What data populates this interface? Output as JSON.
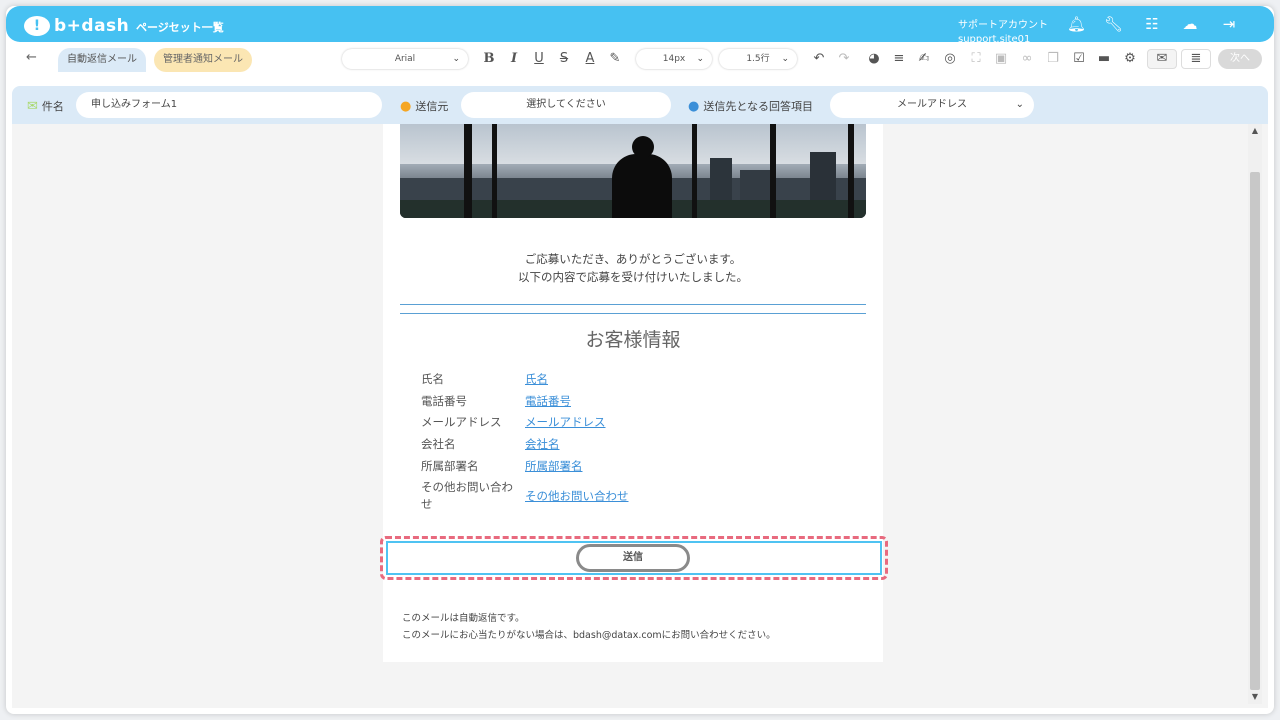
{
  "header": {
    "logo_text": "b+dash",
    "title": "ページセット一覧",
    "account_line1": "サポートアカウント",
    "account_line2": "support.site01"
  },
  "toolbar": {
    "back_glyph": "←",
    "tabs": [
      {
        "label": "自動返信メール",
        "active": true
      },
      {
        "label": "管理者通知メール",
        "active": false
      }
    ],
    "font_select": "Arial",
    "size_select": "14px",
    "line_height_select": "1.5行",
    "next_label": "次へ"
  },
  "subject_bar": {
    "subject_label": "件名",
    "subject_value": "申し込みフォーム1",
    "sender_label": "送信元",
    "sender_placeholder": "選択してください",
    "recipient_label": "送信先となる回答項目",
    "recipient_value": "メールアドレス"
  },
  "email": {
    "greeting_line1": "ご応募いただき、ありがとうございます。",
    "greeting_line2": "以下の内容で応募を受け付けいたしました。",
    "section_title": "お客様情報",
    "rows": [
      {
        "label": "氏名",
        "value": "氏名"
      },
      {
        "label": "電話番号",
        "value": "電話番号"
      },
      {
        "label": "メールアドレス",
        "value": "メールアドレス"
      },
      {
        "label": "会社名",
        "value": "会社名"
      },
      {
        "label": "所属部署名",
        "value": "所属部署名"
      },
      {
        "label_line1": "その他お問い合わ",
        "label_line2": "せ",
        "value": "その他お問い合わせ"
      }
    ],
    "submit_label": "送信",
    "footer_line1": "このメールは自動返信です。",
    "footer_line2": "このメールにお心当たりがない場合は、bdash@datax.comにお問い合わせください。"
  },
  "colors": {
    "brand": "#46c1f2",
    "selection_dash": "#e86a7e",
    "link": "#3b8fd8"
  }
}
